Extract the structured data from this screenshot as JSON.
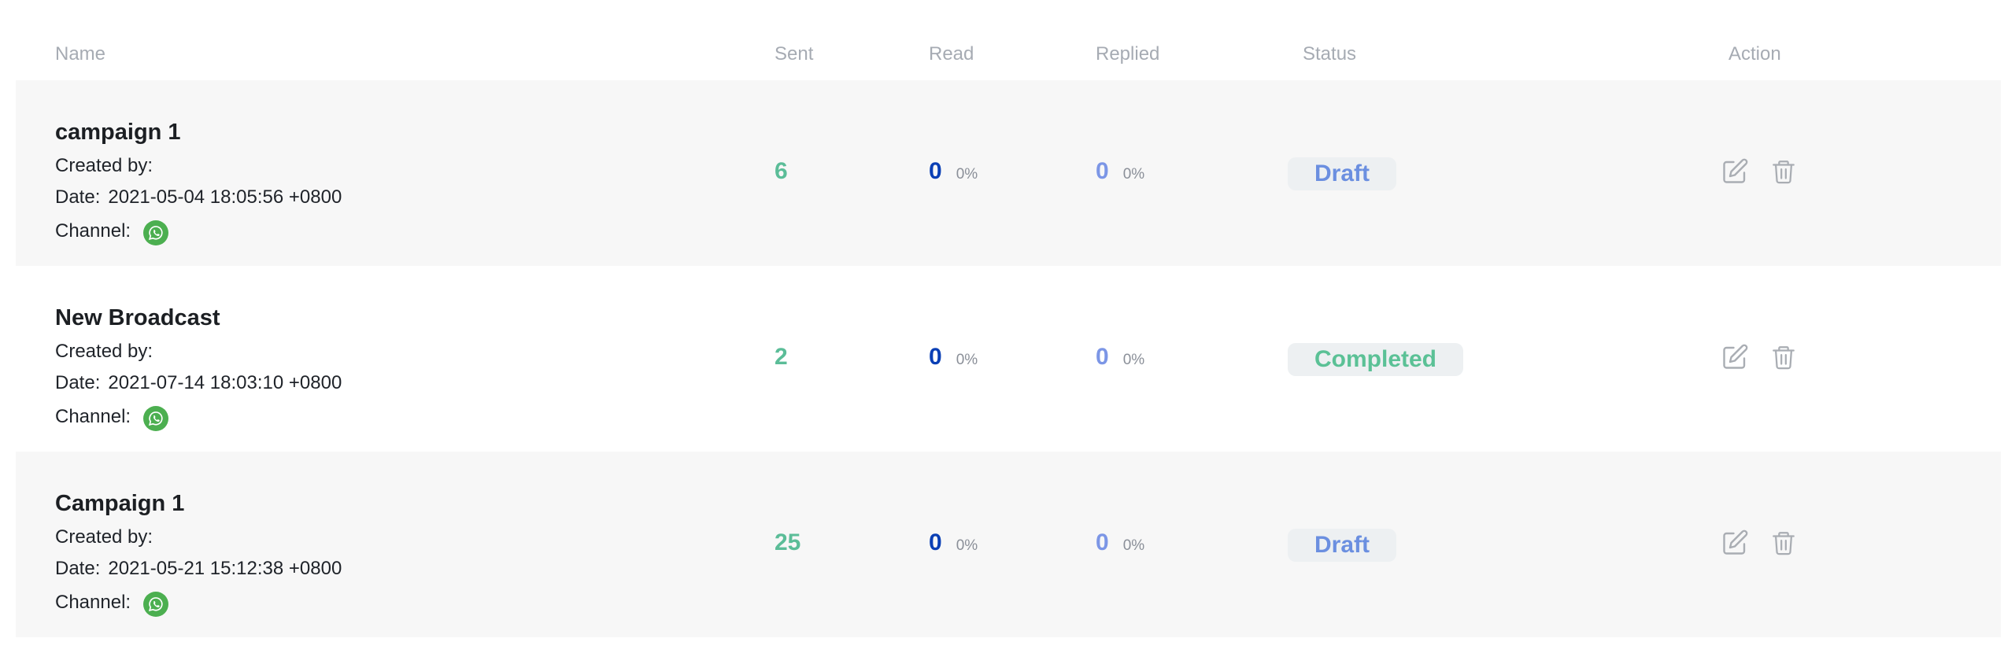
{
  "columns": {
    "name": "Name",
    "sent": "Sent",
    "read": "Read",
    "replied": "Replied",
    "status": "Status",
    "action": "Action"
  },
  "rows": [
    {
      "name": "campaign 1",
      "created_by_label": "Created by:",
      "created_by": "",
      "date_label": "Date:",
      "date": "2021-05-04 18:05:56 +0800",
      "channel_label": "Channel:",
      "channel_icon": "whatsapp-icon",
      "sent": "6",
      "read": "0",
      "read_pct": "0%",
      "replied": "0",
      "replied_pct": "0%",
      "status": "Draft"
    },
    {
      "name": "New Broadcast",
      "created_by_label": "Created by:",
      "created_by": "",
      "date_label": "Date:",
      "date": "2021-07-14 18:03:10 +0800",
      "channel_label": "Channel:",
      "channel_icon": "whatsapp-icon",
      "sent": "2",
      "read": "0",
      "read_pct": "0%",
      "replied": "0",
      "replied_pct": "0%",
      "status": "Completed"
    },
    {
      "name": "Campaign 1",
      "created_by_label": "Created by:",
      "created_by": "",
      "date_label": "Date:",
      "date": "2021-05-21 15:12:38 +0800",
      "channel_label": "Channel:",
      "channel_icon": "whatsapp-icon",
      "sent": "25",
      "read": "0",
      "read_pct": "0%",
      "replied": "0",
      "replied_pct": "0%",
      "status": "Draft"
    }
  ],
  "colors": {
    "sent": "#5bbd98",
    "read": "#0a3fb5",
    "replied": "#7c96e6",
    "draft": "#6b8fe0",
    "completed": "#5bc196",
    "whatsapp": "#4caf50",
    "row_alt_bg": "#f7f7f7"
  },
  "icons": {
    "edit": "edit-icon",
    "delete": "trash-icon"
  }
}
